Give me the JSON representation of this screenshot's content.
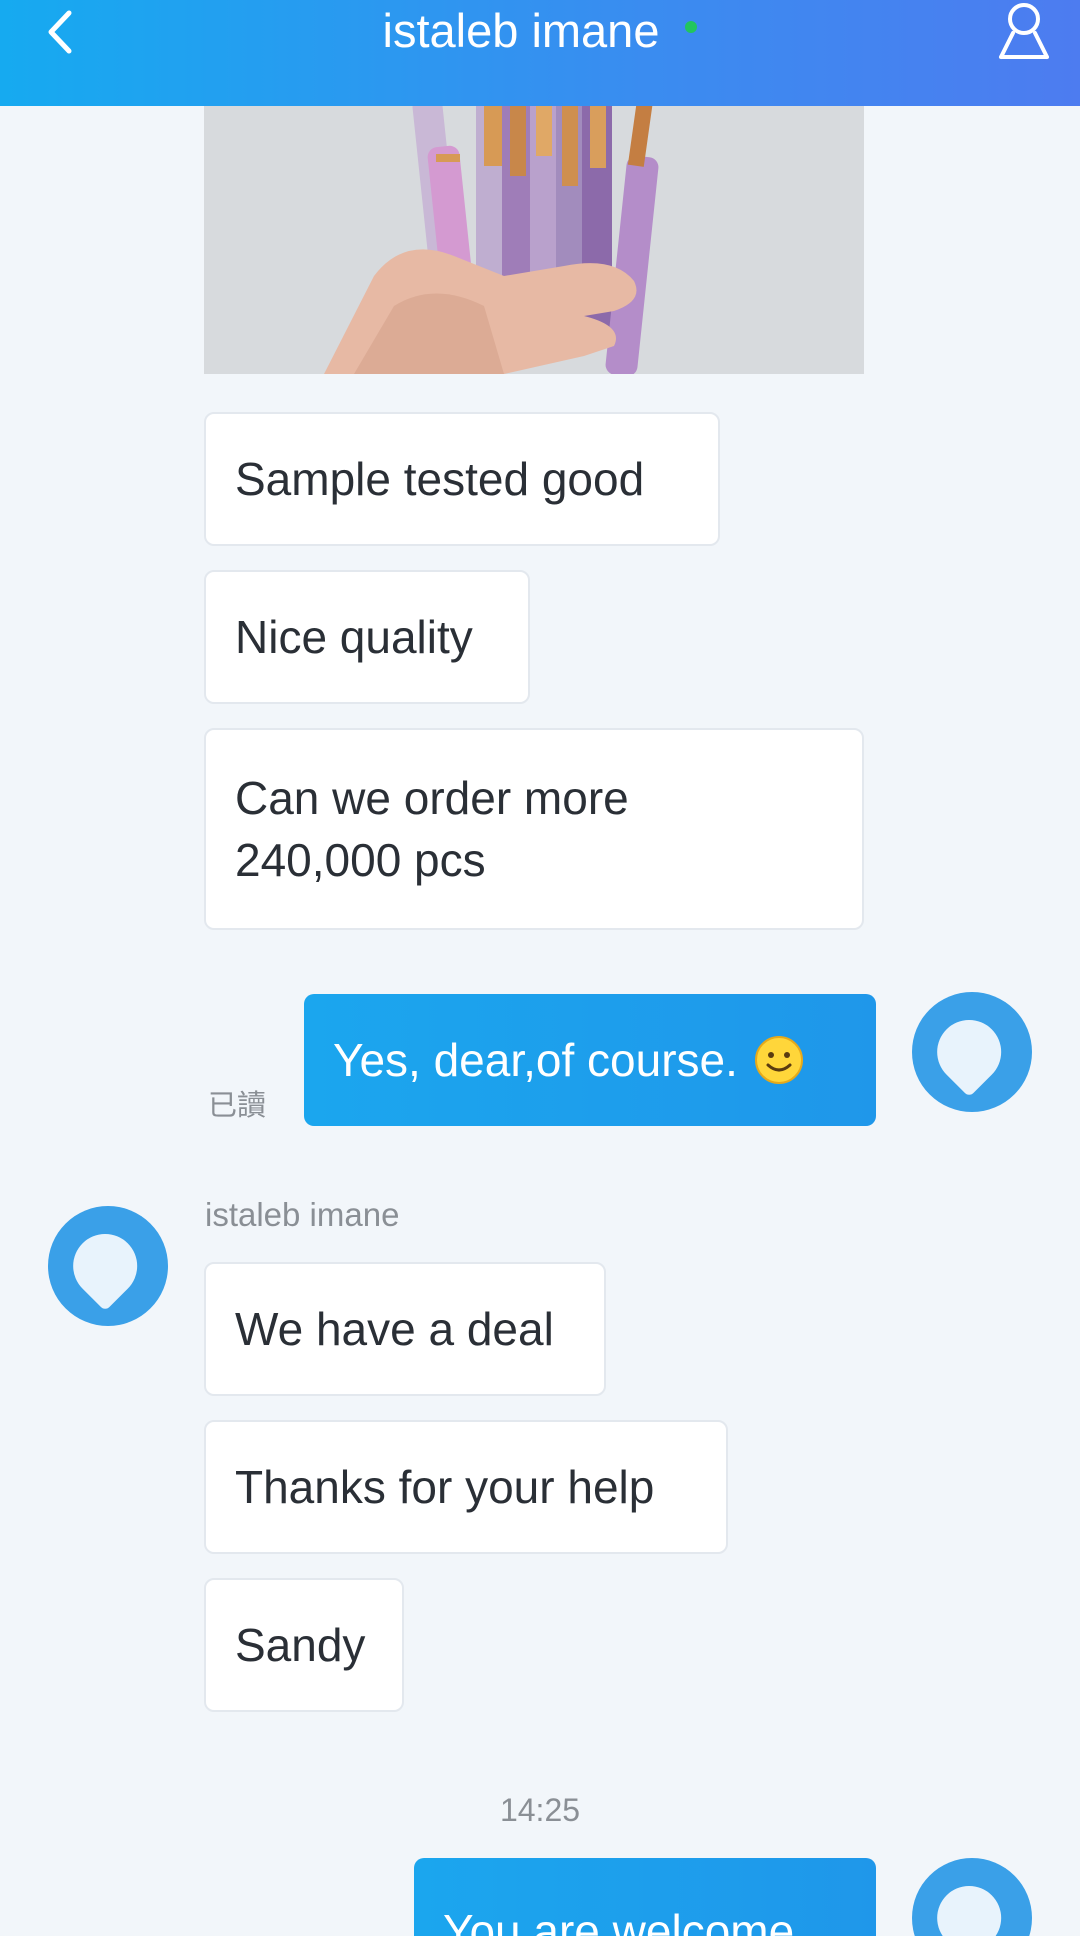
{
  "header": {
    "title": "istaleb imane",
    "online": true,
    "back_icon": "chevron-left-icon",
    "profile_icon": "user-icon",
    "gradient_start": "#16aaf0",
    "gradient_end": "#4d7cf0"
  },
  "messages": [
    {
      "side": "incoming",
      "type": "image",
      "alt_icon": "product-photo-makeup-brushes"
    },
    {
      "side": "incoming",
      "text": "Sample tested good"
    },
    {
      "side": "incoming",
      "text": "Nice quality"
    },
    {
      "side": "incoming",
      "text": "Can we order more 240,000 pcs"
    },
    {
      "side": "outgoing",
      "text": "Yes, dear,of course.",
      "emoji": "smile-emoji",
      "status": "已讀"
    },
    {
      "side": "incoming",
      "sender": "istaleb imane"
    },
    {
      "side": "incoming",
      "text": "We have a deal"
    },
    {
      "side": "incoming",
      "text": "Thanks for your help"
    },
    {
      "side": "incoming",
      "text": "Sandy"
    },
    {
      "type": "timestamp",
      "text": "14:25"
    },
    {
      "side": "outgoing",
      "text": "You are welcome"
    }
  ],
  "colors": {
    "background": "#f2f6fa",
    "outgoing_bubble": "#1ba6ee",
    "incoming_bubble": "#ffffff",
    "avatar": "#3aa0e8"
  }
}
